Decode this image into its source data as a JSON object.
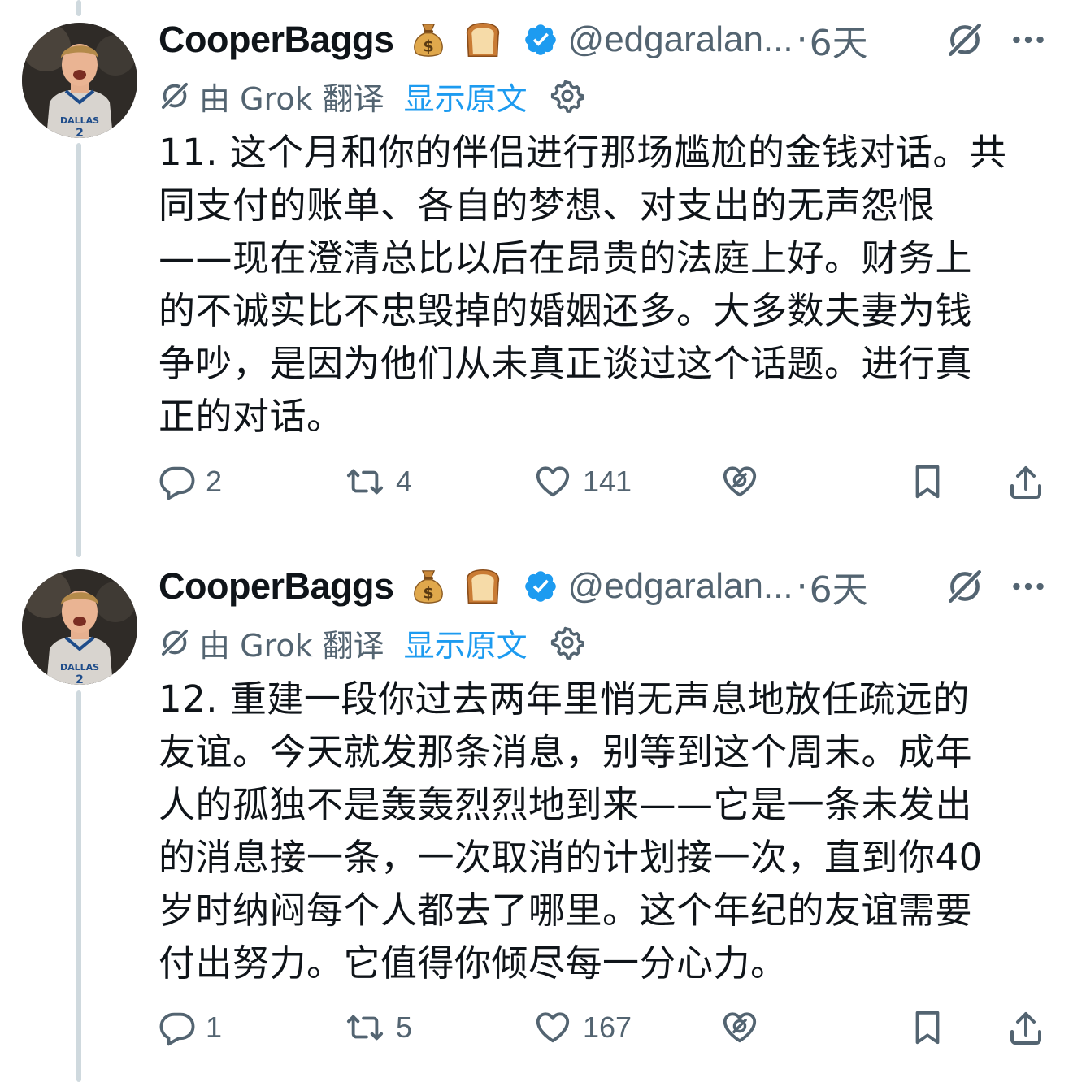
{
  "colors": {
    "text": "#0f1419",
    "secondary": "#536471",
    "link": "#1d9bf0",
    "verified": "#1d9bf0",
    "thread_line": "#cfd9de"
  },
  "tweets": [
    {
      "display_name": "CooperBaggs",
      "emoji_1": "money-bag-emoji",
      "emoji_2": "bread-emoji",
      "handle": "@edgaralan...",
      "separator": "·",
      "time": "6天",
      "translated_by": "由 Grok 翻译",
      "show_original": "显示原文",
      "text": "11. 这个月和你的伴侣进行那场尴尬的金钱对话。共\n同支付的账单、各自的梦想、对支出的无声怨恨\n——现在澄清总比以后在昂贵的法庭上好。财务上\n的不诚实比不忠毁掉的婚姻还多。大多数夫妻为钱\n争吵，是因为他们从未真正谈过这个话题。进行真\n正的对话。",
      "replies": "2",
      "reposts": "4",
      "likes": "141"
    },
    {
      "display_name": "CooperBaggs",
      "emoji_1": "money-bag-emoji",
      "emoji_2": "bread-emoji",
      "handle": "@edgaralan...",
      "separator": "·",
      "time": "6天",
      "translated_by": "由 Grok 翻译",
      "show_original": "显示原文",
      "text": "12. 重建一段你过去两年里悄无声息地放任疏远的\n友谊。今天就发那条消息，别等到这个周末。成年\n人的孤独不是轰轰烈烈地到来——它是一条未发出\n的消息接一条，一次取消的计划接一次，直到你40\n岁时纳闷每个人都去了哪里。这个年纪的友谊需要\n付出努力。它值得你倾尽每一分心力。",
      "replies": "1",
      "reposts": "5",
      "likes": "167"
    }
  ],
  "avatar_jersey_text": "DALLAS",
  "avatar_jersey_number": "2"
}
